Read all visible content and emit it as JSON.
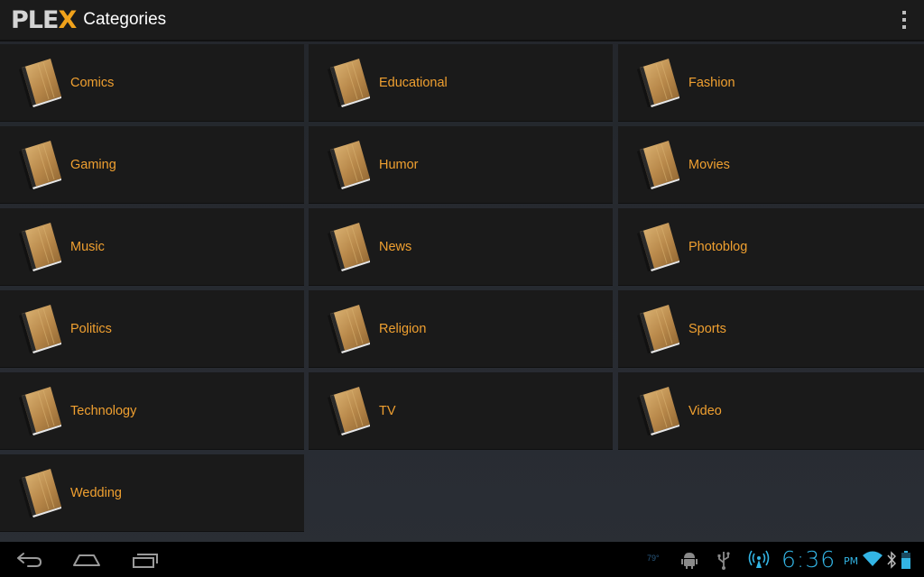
{
  "actionbar": {
    "logo_main": "PLE",
    "logo_accent": "X",
    "title": "Categories",
    "overflow_icon": "overflow-menu-icon"
  },
  "categories": [
    {
      "label": "Comics"
    },
    {
      "label": "Educational"
    },
    {
      "label": "Fashion"
    },
    {
      "label": "Gaming"
    },
    {
      "label": "Humor"
    },
    {
      "label": "Movies"
    },
    {
      "label": "Music"
    },
    {
      "label": "News"
    },
    {
      "label": "Photoblog"
    },
    {
      "label": "Politics"
    },
    {
      "label": "Religion"
    },
    {
      "label": "Sports"
    },
    {
      "label": "Technology"
    },
    {
      "label": "TV"
    },
    {
      "label": "Video"
    },
    {
      "label": "Wedding"
    }
  ],
  "navbar": {
    "back_icon": "back-icon",
    "home_icon": "home-icon",
    "recents_icon": "recent-apps-icon"
  },
  "status": {
    "temperature": "79°",
    "time": "6:36",
    "ampm": "PM",
    "icons": [
      "android-debug-icon",
      "usb-icon",
      "hotspot-icon",
      "wifi-icon",
      "bluetooth-icon",
      "battery-icon"
    ]
  },
  "colors": {
    "accent": "#f0a030",
    "logo_x": "#f0a21b",
    "clock": "#33b5e5",
    "tile_bg": "#1a1a1a"
  }
}
